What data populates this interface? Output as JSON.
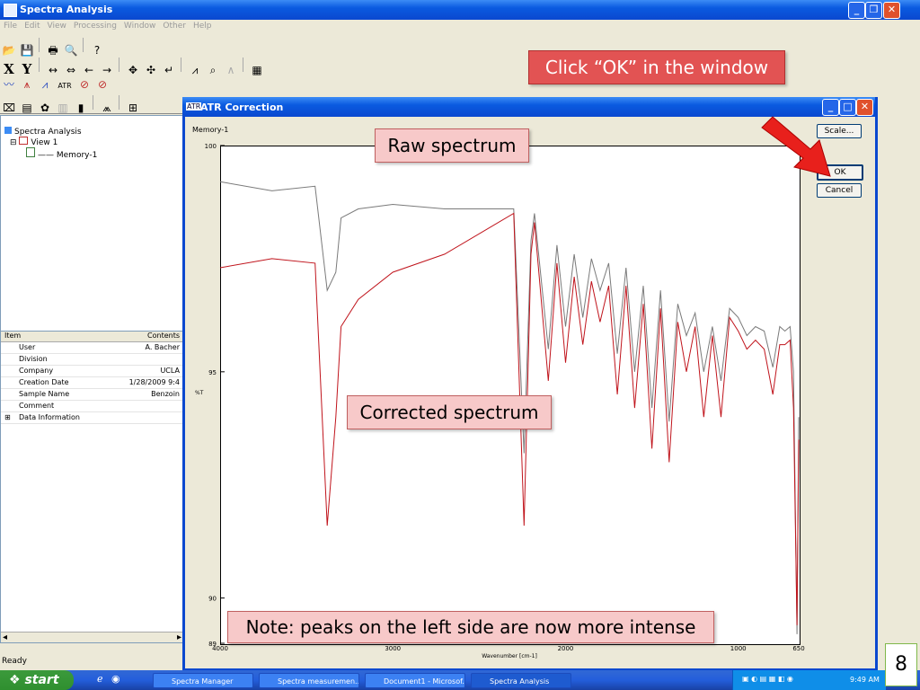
{
  "app": {
    "title": "Spectra Analysis"
  },
  "menu": [
    "File",
    "Edit",
    "View",
    "Processing",
    "Window",
    "Other",
    "Help"
  ],
  "toolbar": {
    "row2_labels": [
      "X",
      "Y"
    ],
    "atr_label": "ATR"
  },
  "tree": {
    "root": "Spectra Analysis",
    "view": "View 1",
    "memory": "Memory-1"
  },
  "properties": {
    "header": {
      "item": "Item",
      "contents": "Contents"
    },
    "rows": [
      {
        "key": "User",
        "value": "A. Bacher"
      },
      {
        "key": "Division",
        "value": ""
      },
      {
        "key": "Company",
        "value": "UCLA"
      },
      {
        "key": "Creation Date",
        "value": "1/28/2009 9:4"
      },
      {
        "key": "Sample Name",
        "value": "Benzoin"
      },
      {
        "key": "Comment",
        "value": ""
      },
      {
        "key": "Data Information",
        "value": ""
      }
    ]
  },
  "status": "Ready",
  "dialog": {
    "title": "ATR Correction",
    "memory_label": "Memory-1",
    "scale_btn": "Scale...",
    "ok_btn": "OK",
    "cancel_btn": "Cancel"
  },
  "chart_data": {
    "type": "line",
    "ylabel": "%T",
    "xlabel": "Wavenumber [cm-1]",
    "xlim": [
      4000,
      650
    ],
    "ylim": [
      89,
      100
    ],
    "x_ticks": [
      "4000",
      "3000",
      "2000",
      "1000",
      "650"
    ],
    "y_ticks": [
      "100",
      "95",
      "90",
      "89"
    ],
    "series": [
      {
        "color": "#7a7a7a",
        "x": [
          4000,
          3700,
          3450,
          3380,
          3330,
          3300,
          3200,
          3000,
          2700,
          2300,
          2240,
          2200,
          2180,
          2100,
          2050,
          2000,
          1950,
          1900,
          1850,
          1800,
          1750,
          1700,
          1650,
          1600,
          1550,
          1500,
          1450,
          1400,
          1350,
          1300,
          1250,
          1200,
          1150,
          1100,
          1050,
          1000,
          950,
          900,
          850,
          800,
          760,
          730,
          700,
          680,
          660,
          650
        ],
        "y": [
          99.2,
          99.0,
          99.1,
          96.8,
          97.2,
          98.4,
          98.6,
          98.7,
          98.6,
          98.6,
          93.2,
          97.9,
          98.5,
          95.5,
          97.8,
          96.0,
          97.6,
          96.2,
          97.5,
          96.8,
          97.4,
          95.4,
          97.3,
          95.0,
          96.9,
          94.2,
          96.8,
          93.9,
          96.5,
          95.8,
          96.3,
          95.0,
          96.0,
          94.8,
          96.4,
          96.2,
          95.8,
          96.0,
          95.9,
          95.1,
          96.0,
          95.9,
          96.0,
          95.0,
          89.2,
          94.0
        ]
      },
      {
        "color": "#c0141c",
        "x": [
          4000,
          3700,
          3450,
          3380,
          3330,
          3300,
          3200,
          3000,
          2700,
          2300,
          2240,
          2200,
          2180,
          2100,
          2050,
          2000,
          1950,
          1900,
          1850,
          1800,
          1750,
          1700,
          1650,
          1600,
          1550,
          1500,
          1450,
          1400,
          1350,
          1300,
          1250,
          1200,
          1150,
          1100,
          1050,
          1000,
          950,
          900,
          850,
          800,
          760,
          730,
          700,
          680,
          660,
          650
        ],
        "y": [
          97.3,
          97.5,
          97.4,
          91.6,
          94.0,
          96.0,
          96.6,
          97.2,
          97.6,
          98.5,
          91.6,
          97.6,
          98.3,
          94.8,
          97.4,
          95.2,
          97.1,
          95.6,
          97.0,
          96.1,
          96.9,
          94.5,
          96.9,
          94.2,
          96.5,
          93.3,
          96.4,
          93.0,
          96.1,
          95.0,
          96.0,
          94.0,
          95.8,
          94.0,
          96.2,
          95.9,
          95.5,
          95.7,
          95.5,
          94.5,
          95.6,
          95.6,
          95.7,
          94.2,
          89.4,
          93.5
        ]
      }
    ]
  },
  "callouts": {
    "ok": "Click “OK” in the window",
    "raw": "Raw spectrum",
    "corrected": "Corrected spectrum",
    "note": "Note: peaks on the left side are now more intense"
  },
  "taskbar": {
    "start": "start",
    "tasks": [
      "Spectra Manager",
      "Spectra measuremen...",
      "Document1 - Microsof...",
      "Spectra Analysis"
    ],
    "clock": "9:49 AM"
  },
  "slide_number": "8",
  "colors": {
    "accent": "#0a5ae0",
    "callout_ok": "#e25353",
    "callout_fill": "#f7c9c9",
    "arrow": "#e8201c"
  }
}
